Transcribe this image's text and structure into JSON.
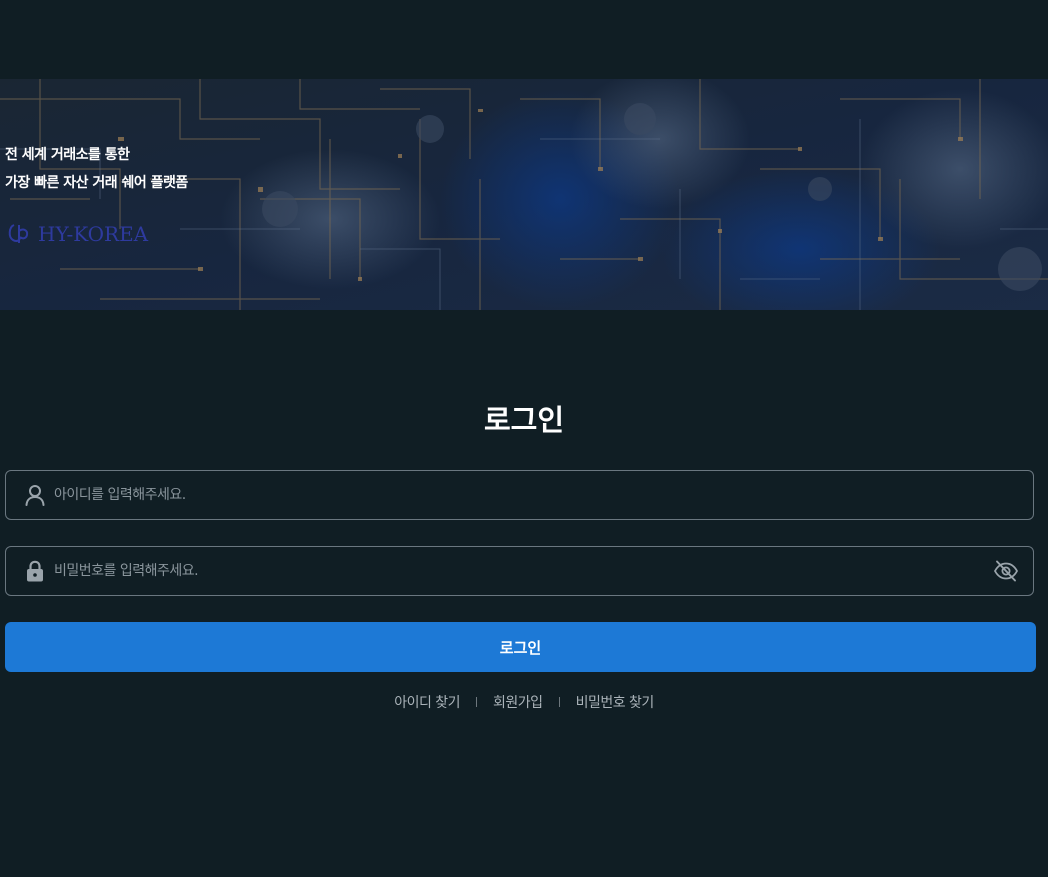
{
  "banner": {
    "headline_line1": "전 세계 거래소를 통한",
    "headline_line2": "가장 빠른 자산 거래 쉐어 플랫폼",
    "logo_text": "HY-KOREA"
  },
  "login": {
    "title": "로그인",
    "id_placeholder": "아이디를 입력해주세요.",
    "password_placeholder": "비밀번호를 입력해주세요.",
    "submit_label": "로그인"
  },
  "links": {
    "find_id": "아이디 찾기",
    "signup": "회원가입",
    "find_password": "비밀번호 찾기"
  },
  "colors": {
    "background": "#101e24",
    "primary_button": "#1d79d6",
    "field_border": "#6a7780"
  },
  "icons": {
    "id_field": "user-icon",
    "password_field": "lock-icon",
    "visibility_toggle": "eye-off-icon"
  }
}
